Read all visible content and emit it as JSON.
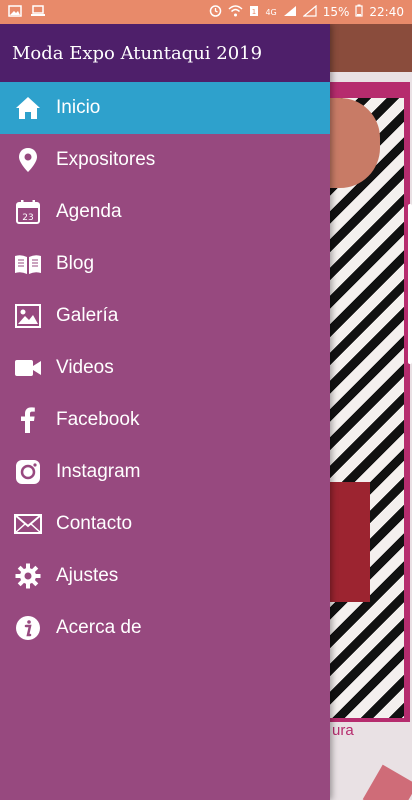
{
  "status_bar": {
    "battery": "15%",
    "time": "22:40",
    "network": "4G"
  },
  "drawer": {
    "title": "Moda Expo Atuntaqui 2019",
    "header_color": "#4e1f6a",
    "background_color": "#97497f",
    "active_color": "#2ea1cc",
    "items": [
      {
        "label": "Inicio",
        "icon": "home-icon",
        "active": true
      },
      {
        "label": "Expositores",
        "icon": "location-pin-icon",
        "active": false
      },
      {
        "label": "Agenda",
        "icon": "calendar-icon",
        "active": false
      },
      {
        "label": "Blog",
        "icon": "book-icon",
        "active": false
      },
      {
        "label": "Galería",
        "icon": "image-icon",
        "active": false
      },
      {
        "label": "Videos",
        "icon": "video-camera-icon",
        "active": false
      },
      {
        "label": "Facebook",
        "icon": "facebook-icon",
        "active": false
      },
      {
        "label": "Instagram",
        "icon": "instagram-icon",
        "active": false
      },
      {
        "label": "Contacto",
        "icon": "envelope-icon",
        "active": false
      },
      {
        "label": "Ajustes",
        "icon": "gear-icon",
        "active": false
      },
      {
        "label": "Acerca de",
        "icon": "info-icon",
        "active": false
      }
    ]
  },
  "calendar_day": "23",
  "background": {
    "partial_text": "ura"
  }
}
